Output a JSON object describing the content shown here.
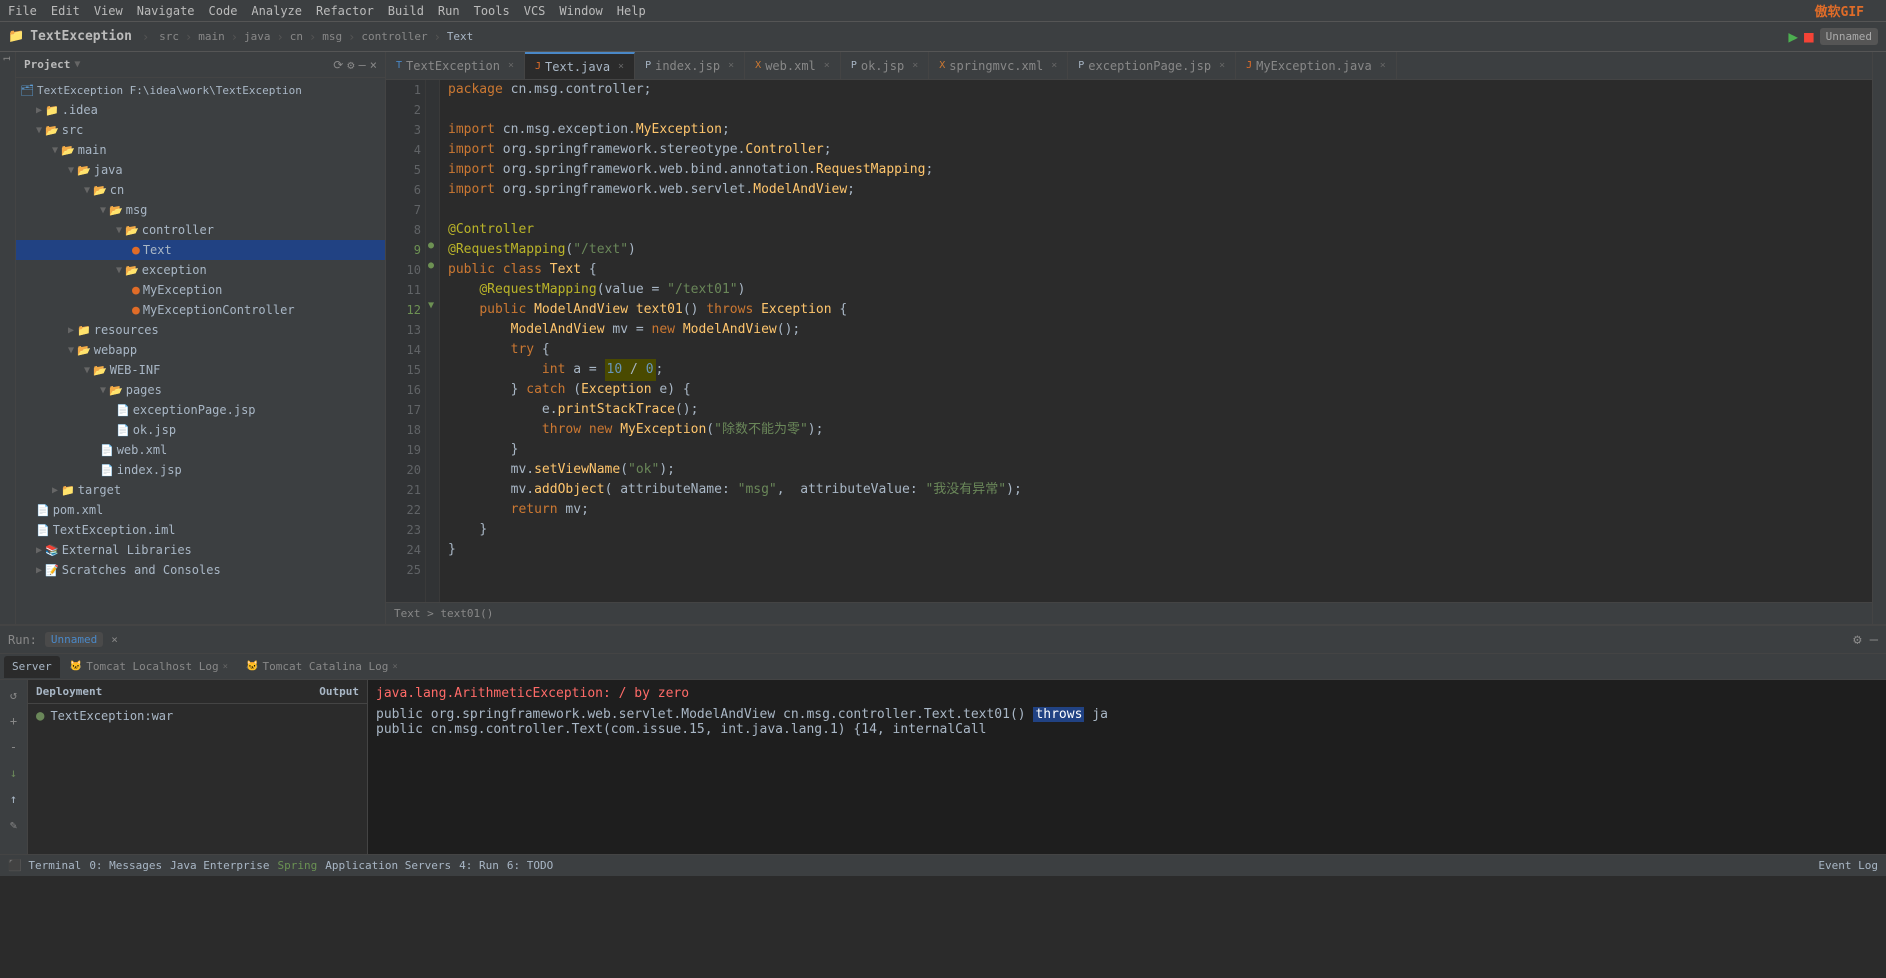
{
  "app": {
    "title": "TextException",
    "logo": "傲软GIF"
  },
  "menu": {
    "items": [
      "File",
      "Edit",
      "View",
      "Navigate",
      "Code",
      "Analyze",
      "Refactor",
      "Build",
      "Run",
      "Tools",
      "VCS",
      "Window",
      "Help"
    ]
  },
  "breadcrumb": {
    "items": [
      "TextException",
      "src",
      "main",
      "java",
      "cn",
      "msg",
      "controller",
      "Text"
    ]
  },
  "project": {
    "title": "Project",
    "root": "TextException",
    "root_path": "F:\\idea\\work\\TextException"
  },
  "tree": [
    {
      "label": "TextException  F:\\idea\\work\\TextException",
      "indent": 0,
      "type": "project",
      "icon": "▼"
    },
    {
      "label": ".idea",
      "indent": 1,
      "type": "folder",
      "icon": "▶"
    },
    {
      "label": "src",
      "indent": 1,
      "type": "folder-open",
      "icon": "▼"
    },
    {
      "label": "main",
      "indent": 2,
      "type": "folder-open",
      "icon": "▼"
    },
    {
      "label": "java",
      "indent": 3,
      "type": "folder-open",
      "icon": "▼"
    },
    {
      "label": "cn",
      "indent": 4,
      "type": "folder-open",
      "icon": "▼"
    },
    {
      "label": "msg",
      "indent": 5,
      "type": "folder-open",
      "icon": "▼"
    },
    {
      "label": "controller",
      "indent": 6,
      "type": "folder-open",
      "icon": "▼"
    },
    {
      "label": "Text",
      "indent": 7,
      "type": "java-selected",
      "icon": "●"
    },
    {
      "label": "exception",
      "indent": 6,
      "type": "folder-open",
      "icon": "▼"
    },
    {
      "label": "MyException",
      "indent": 7,
      "type": "java",
      "icon": "●"
    },
    {
      "label": "MyExceptionController",
      "indent": 7,
      "type": "java",
      "icon": "●"
    },
    {
      "label": "resources",
      "indent": 3,
      "type": "folder",
      "icon": "▶"
    },
    {
      "label": "webapp",
      "indent": 3,
      "type": "folder-open",
      "icon": "▼"
    },
    {
      "label": "WEB-INF",
      "indent": 4,
      "type": "folder-open",
      "icon": "▼"
    },
    {
      "label": "pages",
      "indent": 5,
      "type": "folder-open",
      "icon": "▼"
    },
    {
      "label": "exceptionPage.jsp",
      "indent": 6,
      "type": "jsp",
      "icon": "📄"
    },
    {
      "label": "ok.jsp",
      "indent": 6,
      "type": "jsp",
      "icon": "📄"
    },
    {
      "label": "web.xml",
      "indent": 5,
      "type": "xml",
      "icon": "📄"
    },
    {
      "label": "index.jsp",
      "indent": 5,
      "type": "jsp",
      "icon": "📄"
    },
    {
      "label": "target",
      "indent": 2,
      "type": "folder",
      "icon": "▶"
    },
    {
      "label": "pom.xml",
      "indent": 1,
      "type": "xml",
      "icon": "📄"
    },
    {
      "label": "TextException.iml",
      "indent": 1,
      "type": "iml",
      "icon": "📄"
    },
    {
      "label": "External Libraries",
      "indent": 1,
      "type": "lib",
      "icon": "▶"
    },
    {
      "label": "Scratches and Consoles",
      "indent": 1,
      "type": "scratch",
      "icon": "▶"
    }
  ],
  "tabs": [
    {
      "label": "TextException",
      "active": false,
      "icon": "T",
      "closable": true
    },
    {
      "label": "Text.java",
      "active": true,
      "icon": "J",
      "closable": true
    },
    {
      "label": "index.jsp",
      "active": false,
      "icon": "P",
      "closable": true
    },
    {
      "label": "web.xml",
      "active": false,
      "icon": "X",
      "closable": true
    },
    {
      "label": "ok.jsp",
      "active": false,
      "icon": "P",
      "closable": true
    },
    {
      "label": "springmvc.xml",
      "active": false,
      "icon": "X",
      "closable": true
    },
    {
      "label": "exceptionPage.jsp",
      "active": false,
      "icon": "P",
      "closable": true
    },
    {
      "label": "MyException.java",
      "active": false,
      "icon": "J",
      "closable": true
    }
  ],
  "code": {
    "package": "package cn.msg.controller;",
    "imports": [
      "import cn.msg.exception.MyException;",
      "import org.springframework.stereotype.Controller;",
      "import org.springframework.web.bind.annotation.RequestMapping;",
      "import org.springframework.web.servlet.ModelAndView;"
    ],
    "lines": [
      {
        "num": 1,
        "text": "package cn.msg.controller;"
      },
      {
        "num": 2,
        "text": ""
      },
      {
        "num": 3,
        "text": "import cn.msg.exception.MyException;"
      },
      {
        "num": 4,
        "text": "import org.springframework.stereotype.Controller;"
      },
      {
        "num": 5,
        "text": "import org.springframework.web.bind.annotation.RequestMapping;"
      },
      {
        "num": 6,
        "text": "import org.springframework.web.servlet.ModelAndView;"
      },
      {
        "num": 7,
        "text": ""
      },
      {
        "num": 8,
        "text": "@Controller"
      },
      {
        "num": 9,
        "text": "@RequestMapping(\"/text\")"
      },
      {
        "num": 10,
        "text": "public class Text {"
      },
      {
        "num": 11,
        "text": "    @RequestMapping(value = \"/text01\")"
      },
      {
        "num": 12,
        "text": "    public ModelAndView text01() throws Exception {"
      },
      {
        "num": 13,
        "text": "        ModelAndView mv = new ModelAndView();"
      },
      {
        "num": 14,
        "text": "        try {"
      },
      {
        "num": 15,
        "text": "            int a = 10 / 0;"
      },
      {
        "num": 16,
        "text": "        } catch (Exception e) {"
      },
      {
        "num": 17,
        "text": "            e.printStackTrace();"
      },
      {
        "num": 18,
        "text": "            throw new MyException(\"除数不能为零\");"
      },
      {
        "num": 19,
        "text": "        }"
      },
      {
        "num": 20,
        "text": "        mv.setViewName(\"ok\");"
      },
      {
        "num": 21,
        "text": "        mv.addObject( attributeName: \"msg\",  attributeValue: \"我没有异常\");"
      },
      {
        "num": 22,
        "text": "        return mv;"
      },
      {
        "num": 23,
        "text": "    }"
      },
      {
        "num": 24,
        "text": "}"
      },
      {
        "num": 25,
        "text": ""
      }
    ]
  },
  "editor_status": {
    "breadcrumb": "Text > text01()"
  },
  "run_bar": {
    "label": "Run:",
    "config": "Unnamed",
    "close": "×"
  },
  "bottom_tabs": [
    {
      "label": "Server",
      "active": true
    },
    {
      "label": "Tomcat Localhost Log",
      "active": false
    },
    {
      "label": "Tomcat Catalina Log",
      "active": false
    }
  ],
  "deployment": {
    "header_left": "Deployment",
    "header_right": "Output",
    "item": "TextException:war"
  },
  "console_output": [
    {
      "text": "java.lang.ArithmeticException: / by zero",
      "type": "error"
    },
    {
      "text": "    public org.springframework.web.servlet.ModelAndView cn.msg.controller.Text.text01() throws ja",
      "type": "normal",
      "highlight": "throws"
    },
    {
      "text": "    public cn.msg.controller.Text(com.issue.15, int.java.lang.1) {14, internalCall",
      "type": "normal"
    }
  ],
  "status_bar": {
    "left_items": [
      "Terminal",
      "0: Messages",
      "Java Enterprise",
      "Spring",
      "Application Servers",
      "4: Run",
      "6: TODO"
    ],
    "right_items": [
      "Event Log"
    ]
  },
  "colors": {
    "accent_blue": "#4a88c7",
    "selected_bg": "#214283",
    "error_red": "#ff6b68",
    "green": "#6a8759"
  }
}
